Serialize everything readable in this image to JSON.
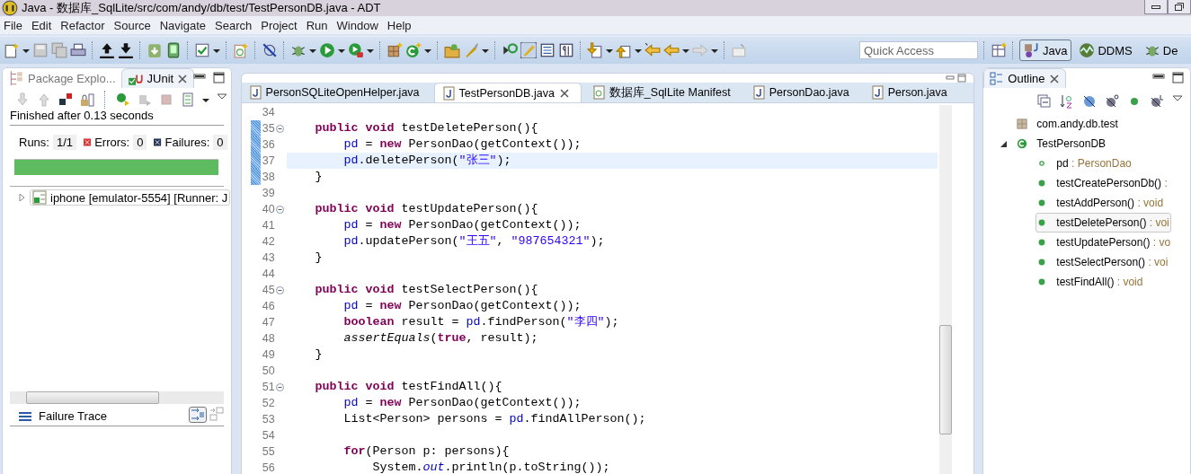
{
  "window": {
    "title": "Java - 数据库_SqlLite/src/com/andy/db/test/TestPersonDB.java - ADT"
  },
  "menu": [
    "File",
    "Edit",
    "Refactor",
    "Source",
    "Navigate",
    "Search",
    "Project",
    "Run",
    "Window",
    "Help"
  ],
  "toolbar": {
    "quick_access": {
      "placeholder": "Quick Access"
    },
    "perspectives": [
      {
        "label": "Java",
        "selected": true,
        "kind": "java"
      },
      {
        "label": "DDMS",
        "selected": false,
        "kind": "ddms"
      },
      {
        "label": "De",
        "selected": false,
        "kind": "debug"
      }
    ]
  },
  "left_panel": {
    "tabs": [
      {
        "label": "Package Explo...",
        "selected": false,
        "kind": "package"
      },
      {
        "label": "JUnit",
        "selected": true,
        "kind": "junit"
      }
    ],
    "status": "Finished after 0.13 seconds",
    "counters": [
      {
        "label": "Runs:",
        "value": "1/1",
        "kind": "runs"
      },
      {
        "label": "Errors:",
        "value": "0",
        "kind": "errors"
      },
      {
        "label": "Failures:",
        "value": "0",
        "kind": "failures"
      }
    ],
    "progress": {
      "level": 1
    },
    "tree": [
      {
        "label": "iphone [emulator-5554] [Runner: J",
        "expanded": false
      }
    ],
    "failure_trace": {
      "title": "Failure Trace"
    }
  },
  "editor": {
    "tabs": [
      {
        "label": "PersonSQLiteOpenHelper.java",
        "selected": false,
        "kind": "java"
      },
      {
        "label": "TestPersonDB.java",
        "selected": true,
        "kind": "java"
      },
      {
        "label": "数据库_SqlLite Manifest",
        "selected": false,
        "kind": "manifest"
      },
      {
        "label": "PersonDao.java",
        "selected": false,
        "kind": "java"
      },
      {
        "label": "Person.java",
        "selected": false,
        "kind": "java"
      }
    ],
    "lines": [
      {
        "number": "34",
        "changed": false,
        "foldable": false,
        "current": false
      },
      {
        "number": "35",
        "changed": true,
        "foldable": true,
        "current": false,
        "tokens": [
          {
            "kind": "keyword",
            "text": "    public"
          },
          {
            "kind": "keyword",
            "text": " void"
          },
          {
            "kind": "plain",
            "text": " testDeletePerson(){"
          }
        ]
      },
      {
        "number": "36",
        "changed": true,
        "foldable": false,
        "current": false,
        "tokens": [
          {
            "kind": "field",
            "text": "        pd"
          },
          {
            "kind": "plain",
            "text": " = "
          },
          {
            "kind": "keyword",
            "text": "new"
          },
          {
            "kind": "plain",
            "text": " PersonDao(getContext());"
          }
        ]
      },
      {
        "number": "37",
        "changed": true,
        "foldable": false,
        "current": true,
        "tokens": [
          {
            "kind": "field",
            "text": "        pd"
          },
          {
            "kind": "plain",
            "text": ".deletePerson("
          },
          {
            "kind": "string",
            "text": "\"张三\""
          },
          {
            "kind": "plain",
            "text": ");"
          }
        ]
      },
      {
        "number": "38",
        "changed": true,
        "foldable": false,
        "current": false,
        "tokens": [
          {
            "kind": "plain",
            "text": "    }"
          }
        ]
      },
      {
        "number": "39",
        "changed": false,
        "foldable": false,
        "current": false
      },
      {
        "number": "40",
        "changed": false,
        "foldable": true,
        "current": false,
        "tokens": [
          {
            "kind": "keyword",
            "text": "    public"
          },
          {
            "kind": "keyword",
            "text": " void"
          },
          {
            "kind": "plain",
            "text": " testUpdatePerson(){"
          }
        ]
      },
      {
        "number": "41",
        "changed": false,
        "foldable": false,
        "current": false,
        "tokens": [
          {
            "kind": "field",
            "text": "        pd"
          },
          {
            "kind": "plain",
            "text": " = "
          },
          {
            "kind": "keyword",
            "text": "new"
          },
          {
            "kind": "plain",
            "text": " PersonDao(getContext());"
          }
        ]
      },
      {
        "number": "42",
        "changed": false,
        "foldable": false,
        "current": false,
        "tokens": [
          {
            "kind": "field",
            "text": "        pd"
          },
          {
            "kind": "plain",
            "text": ".updatePerson("
          },
          {
            "kind": "string",
            "text": "\"王五\""
          },
          {
            "kind": "plain",
            "text": ", "
          },
          {
            "kind": "string",
            "text": "\"987654321\""
          },
          {
            "kind": "plain",
            "text": ");"
          }
        ]
      },
      {
        "number": "43",
        "changed": false,
        "foldable": false,
        "current": false,
        "tokens": [
          {
            "kind": "plain",
            "text": "    }"
          }
        ]
      },
      {
        "number": "44",
        "changed": false,
        "foldable": false,
        "current": false
      },
      {
        "number": "45",
        "changed": false,
        "foldable": true,
        "current": false,
        "tokens": [
          {
            "kind": "keyword",
            "text": "    public"
          },
          {
            "kind": "keyword",
            "text": " void"
          },
          {
            "kind": "plain",
            "text": " testSelectPerson(){"
          }
        ]
      },
      {
        "number": "46",
        "changed": false,
        "foldable": false,
        "current": false,
        "tokens": [
          {
            "kind": "field",
            "text": "        pd"
          },
          {
            "kind": "plain",
            "text": " = "
          },
          {
            "kind": "keyword",
            "text": "new"
          },
          {
            "kind": "plain",
            "text": " PersonDao(getContext());"
          }
        ]
      },
      {
        "number": "47",
        "changed": false,
        "foldable": false,
        "current": false,
        "tokens": [
          {
            "kind": "keyword",
            "text": "        boolean"
          },
          {
            "kind": "plain",
            "text": " result = "
          },
          {
            "kind": "field",
            "text": "pd"
          },
          {
            "kind": "plain",
            "text": ".findPerson("
          },
          {
            "kind": "string",
            "text": "\"李四\""
          },
          {
            "kind": "plain",
            "text": ");"
          }
        ]
      },
      {
        "number": "48",
        "changed": false,
        "foldable": false,
        "current": false,
        "tokens": [
          {
            "kind": "static_method",
            "text": "        assertEquals"
          },
          {
            "kind": "plain",
            "text": "("
          },
          {
            "kind": "keyword",
            "text": "true"
          },
          {
            "kind": "plain",
            "text": ", result);"
          }
        ]
      },
      {
        "number": "49",
        "changed": false,
        "foldable": false,
        "current": false,
        "tokens": [
          {
            "kind": "plain",
            "text": "    }"
          }
        ]
      },
      {
        "number": "50",
        "changed": false,
        "foldable": false,
        "current": false
      },
      {
        "number": "51",
        "changed": false,
        "foldable": true,
        "current": false,
        "tokens": [
          {
            "kind": "keyword",
            "text": "    public"
          },
          {
            "kind": "keyword",
            "text": " void"
          },
          {
            "kind": "plain",
            "text": " testFindAll(){"
          }
        ]
      },
      {
        "number": "52",
        "changed": false,
        "foldable": false,
        "current": false,
        "tokens": [
          {
            "kind": "field",
            "text": "        pd"
          },
          {
            "kind": "plain",
            "text": " = "
          },
          {
            "kind": "keyword",
            "text": "new"
          },
          {
            "kind": "plain",
            "text": " PersonDao(getContext());"
          }
        ]
      },
      {
        "number": "53",
        "changed": false,
        "foldable": false,
        "current": false,
        "tokens": [
          {
            "kind": "plain",
            "text": "        List<Person> persons = "
          },
          {
            "kind": "field",
            "text": "pd"
          },
          {
            "kind": "plain",
            "text": ".findAllPerson();"
          }
        ]
      },
      {
        "number": "54",
        "changed": false,
        "foldable": false,
        "current": false
      },
      {
        "number": "55",
        "changed": false,
        "foldable": false,
        "current": false,
        "tokens": [
          {
            "kind": "keyword",
            "text": "        for"
          },
          {
            "kind": "plain",
            "text": "(Person p: persons){"
          }
        ]
      },
      {
        "number": "56",
        "changed": false,
        "foldable": false,
        "current": false,
        "tokens": [
          {
            "kind": "plain",
            "text": "            System."
          },
          {
            "kind": "static_field",
            "text": "out"
          },
          {
            "kind": "plain",
            "text": ".println(p.toString());"
          }
        ]
      }
    ]
  },
  "outline": {
    "tab": {
      "label": "Outline",
      "selected": true
    },
    "items": [
      {
        "kind": "package",
        "name": "com.andy.db.test",
        "selected": false
      },
      {
        "kind": "class",
        "name": "TestPersonDB",
        "selected": false,
        "expanded": true,
        "children": [
          {
            "kind": "field",
            "name": "pd",
            "detail": " : PersonDao",
            "selected": false
          },
          {
            "kind": "method",
            "name": "testCreatePersonDb()",
            "detail": " :",
            "selected": false
          },
          {
            "kind": "method",
            "name": "testAddPerson()",
            "detail": " : void",
            "selected": false
          },
          {
            "kind": "method",
            "name": "testDeletePerson()",
            "detail": " : voi",
            "selected": true
          },
          {
            "kind": "method",
            "name": "testUpdatePerson()",
            "detail": " : vo",
            "selected": false
          },
          {
            "kind": "method",
            "name": "testSelectPerson()",
            "detail": " : voi",
            "selected": false
          },
          {
            "kind": "method",
            "name": "testFindAll()",
            "detail": " : void",
            "selected": false
          }
        ]
      }
    ]
  }
}
